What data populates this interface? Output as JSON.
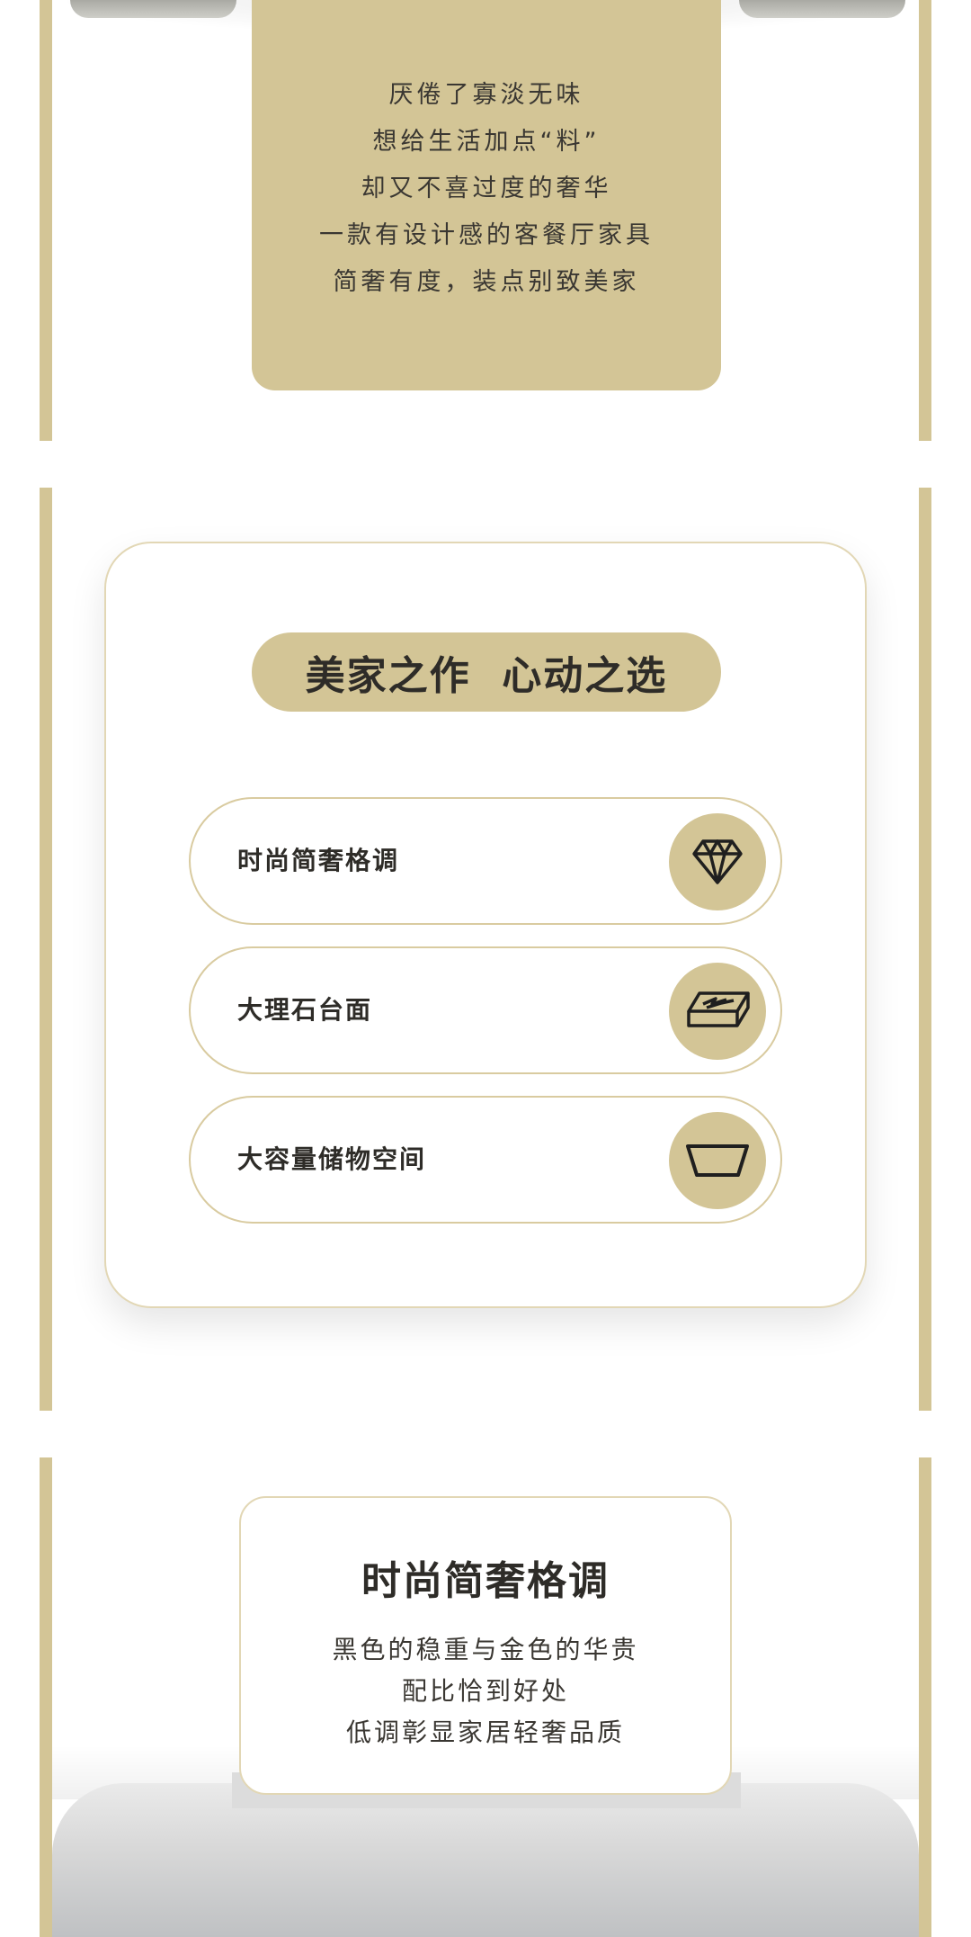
{
  "colors": {
    "accent_gold": "#d3c596",
    "text_dark": "#2e2c28",
    "card_border": "#e2d7b5"
  },
  "intro": {
    "lines": [
      "厌倦了寡淡无味",
      "想给生活加点“料”",
      "却又不喜过度的奢华",
      "一款有设计感的客餐厅家具",
      "简奢有度，装点别致美家"
    ]
  },
  "features": {
    "title": "美家之作  心动之选",
    "items": [
      {
        "label": "时尚简奢格调",
        "icon": "diamond-icon"
      },
      {
        "label": "大理石台面",
        "icon": "marble-slab-icon"
      },
      {
        "label": "大容量储物空间",
        "icon": "storage-bin-icon"
      }
    ]
  },
  "detail": {
    "title": "时尚简奢格调",
    "lines": [
      "黑色的稳重与金色的华贵",
      "配比恰到好处",
      "低调彰显家居轻奢品质"
    ]
  }
}
